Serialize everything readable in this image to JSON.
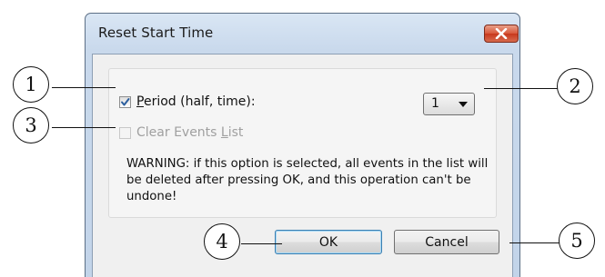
{
  "window": {
    "title": "Reset Start Time"
  },
  "options": {
    "period_label_accel": "P",
    "period_label_rest": "eriod (half, time):",
    "period_checked": true,
    "clear_label_pre": "Clear Events ",
    "clear_label_accel": "L",
    "clear_label_rest": "ist",
    "clear_enabled": false,
    "period_select_value": "1",
    "warning": "WARNING: if this option is selected, all events in the list will be deleted after pressing OK, and this operation can't be undone!"
  },
  "buttons": {
    "ok_label": "OK",
    "cancel_label": "Cancel"
  },
  "callouts": [
    "1",
    "2",
    "3",
    "4",
    "5"
  ],
  "icons": {
    "close": "close-icon",
    "dropdown": "chevron-down-icon",
    "check": "checkmark-icon"
  },
  "colors": {
    "title_bar": "#c9d9ec",
    "close_button": "#c8381c",
    "client_bg": "#f0f0f0",
    "ok_focus_border": "#3c7fb1"
  }
}
